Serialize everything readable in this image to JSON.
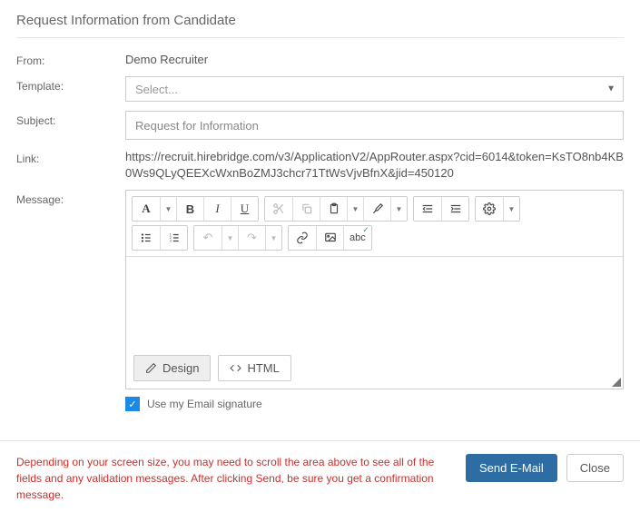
{
  "title": "Request Information from Candidate",
  "labels": {
    "from": "From:",
    "template": "Template:",
    "subject": "Subject:",
    "link": "Link:",
    "message": "Message:"
  },
  "from_value": "Demo Recruiter",
  "template": {
    "placeholder": "Select..."
  },
  "subject": {
    "value": "Request for Information"
  },
  "link": "https://recruit.hirebridge.com/v3/ApplicationV2/AppRouter.aspx?cid=6014&token=KsTO8nb4KB0Ws9QLyQEEXcWxnBoZMJ3chcr71TtWsVjvBfnX&jid=450120",
  "editor": {
    "design_label": "Design",
    "html_label": "HTML"
  },
  "signature": {
    "label": "Use my Email signature",
    "checked": true
  },
  "warning": "Depending on your screen size, you may need to scroll the area above to see all of the fields and any validation messages. After clicking Send, be sure you get a confirmation message.",
  "buttons": {
    "send": "Send E-Mail",
    "close": "Close"
  },
  "glyphs": {
    "font_a": "A",
    "bold": "B",
    "italic": "I",
    "underline": "U",
    "caret": "▼",
    "check": "✓",
    "undo": "↶",
    "redo": "↷",
    "link": "⛓",
    "spellcheck": "abc"
  }
}
